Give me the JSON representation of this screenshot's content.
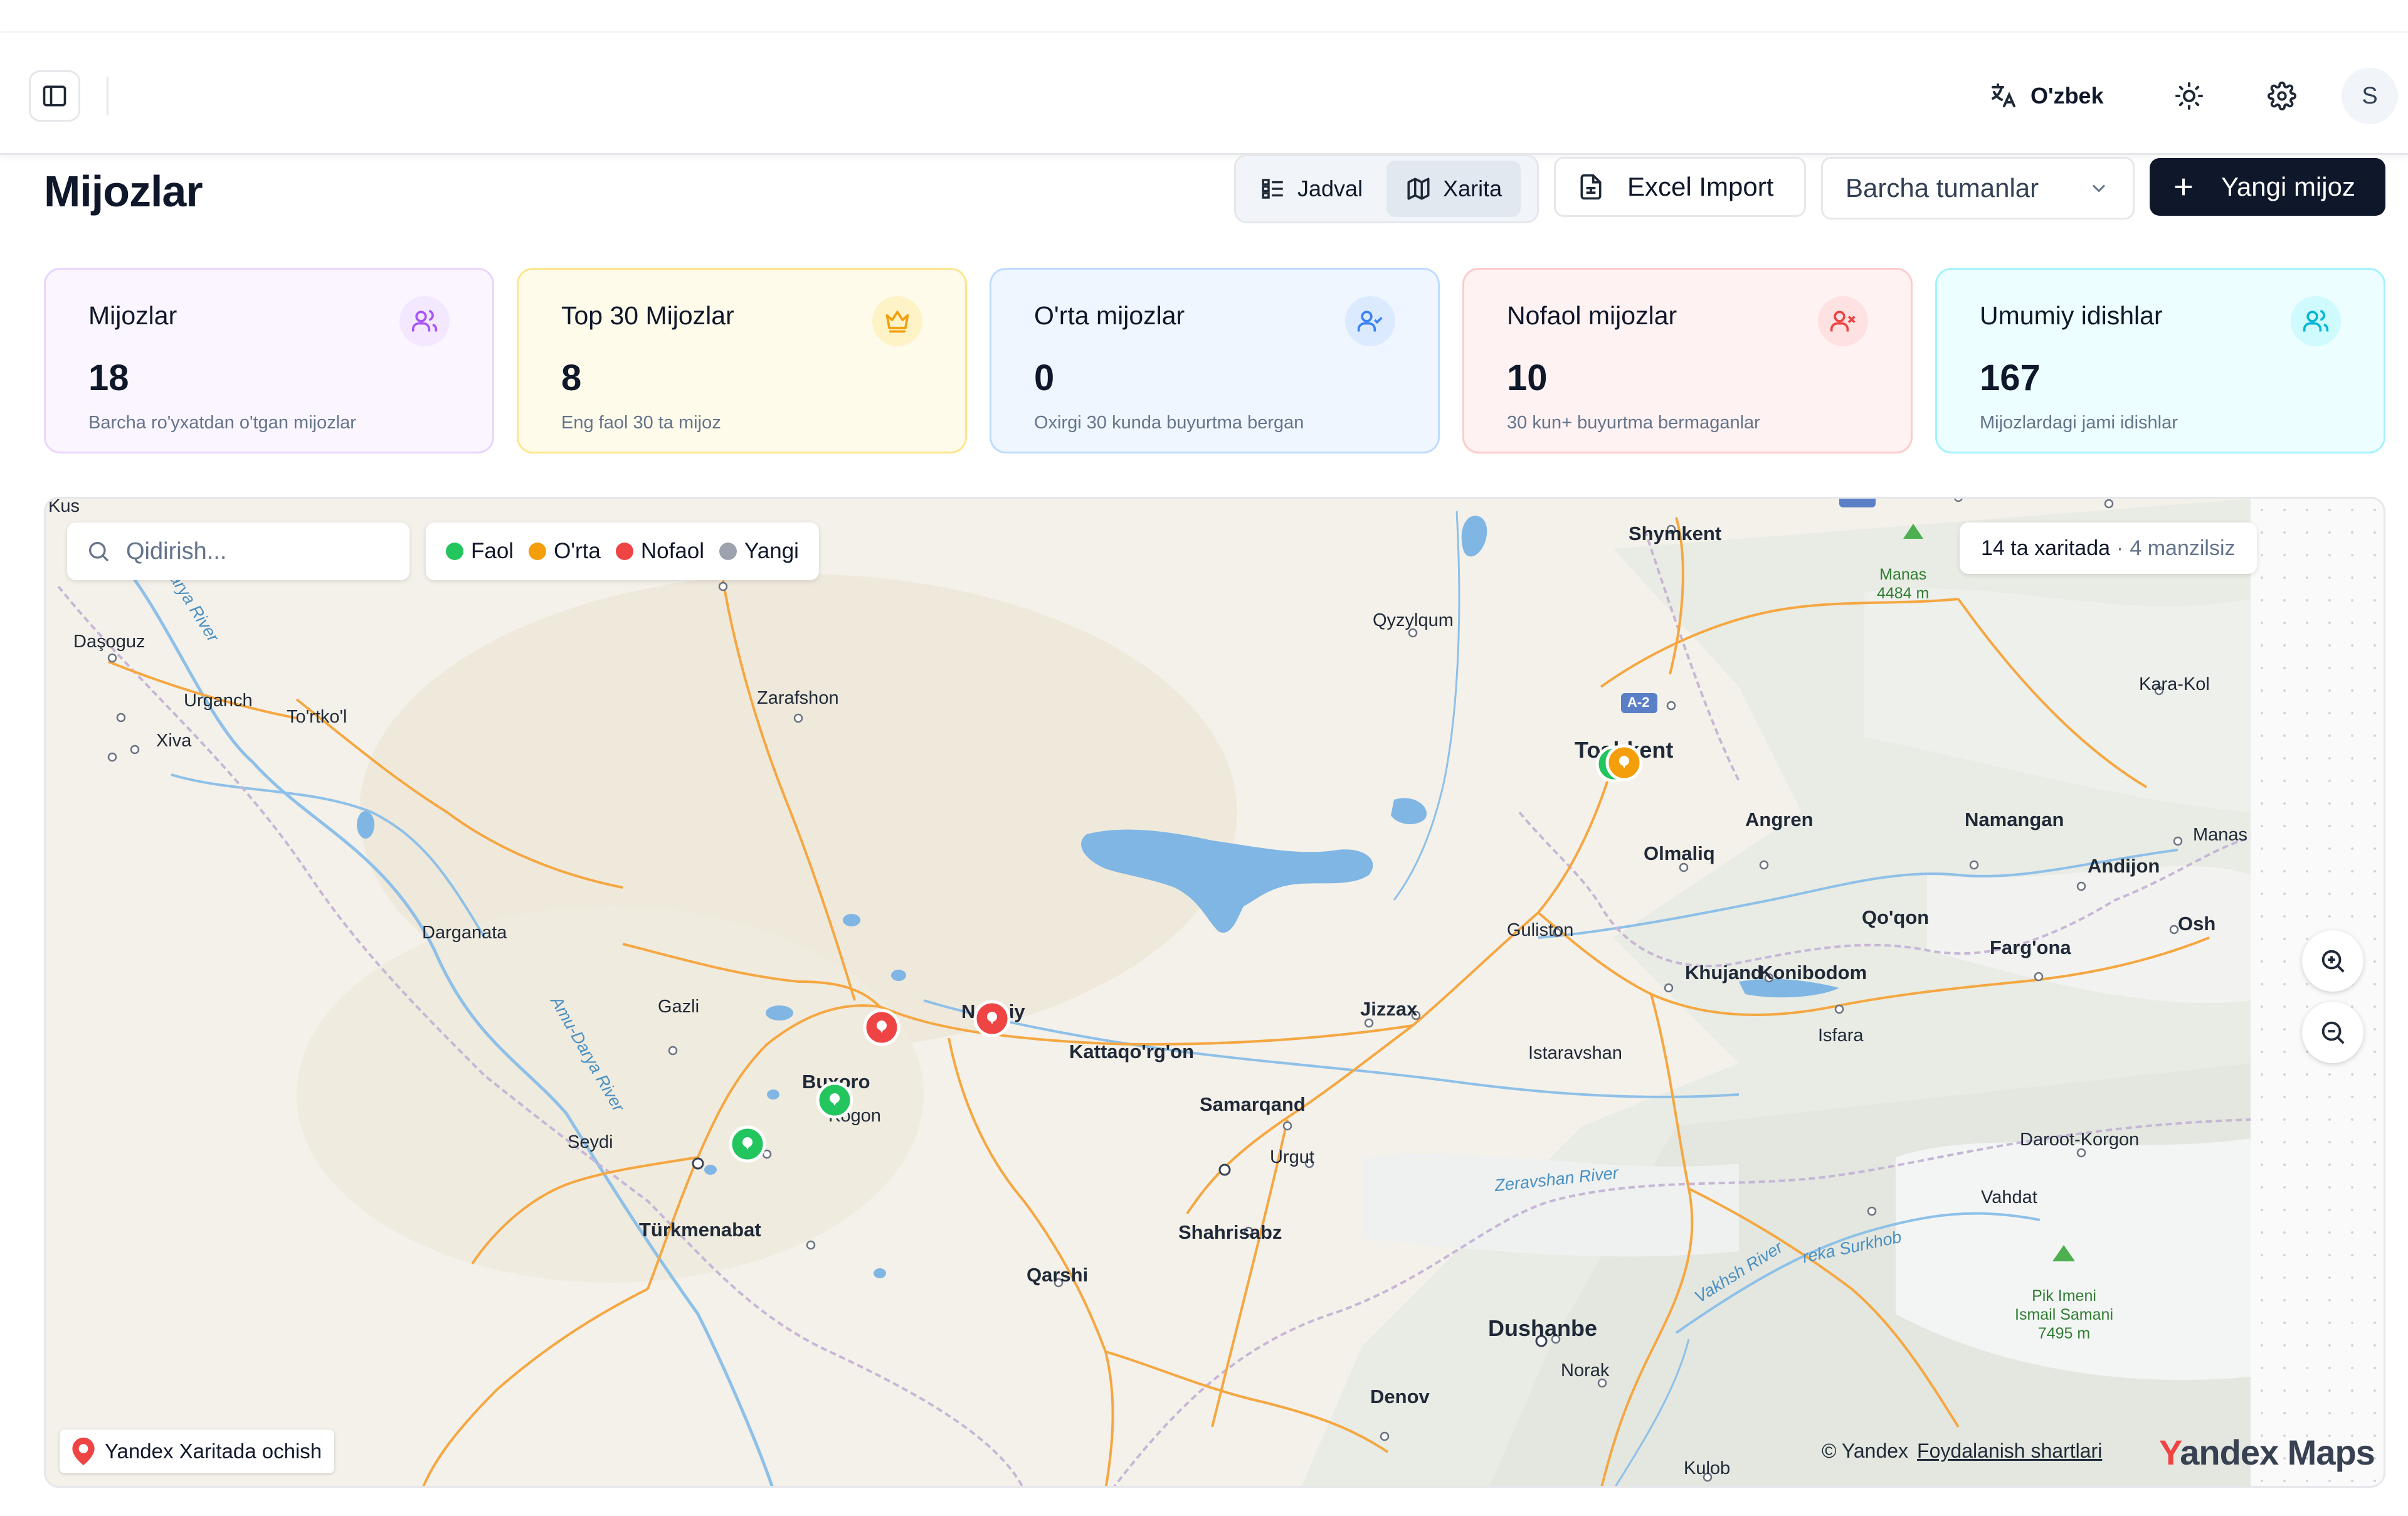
{
  "header": {
    "language_label": "O'zbek",
    "avatar_initial": "S"
  },
  "page": {
    "title": "Mijozlar"
  },
  "toolbar": {
    "view_table_label": "Jadval",
    "view_map_label": "Xarita",
    "excel_import_label": "Excel Import",
    "district_select_value": "Barcha tumanlar",
    "new_client_label": "Yangi mijoz"
  },
  "stats": [
    {
      "title": "Mijozlar",
      "value": "18",
      "desc": "Barcha ro'yxatdan o'tgan mijozlar",
      "icon": "users-icon",
      "accent": "#a855f7",
      "bg": "#faf5ff",
      "border": "#e9d5ff"
    },
    {
      "title": "Top 30 Mijozlar",
      "value": "8",
      "desc": "Eng faol 30 ta mijoz",
      "icon": "crown-icon",
      "accent": "#f59e0b",
      "bg": "#fffbeb",
      "border": "#fde68a"
    },
    {
      "title": "O'rta mijozlar",
      "value": "0",
      "desc": "Oxirgi 30 kunda buyurtma bergan",
      "icon": "user-check-icon",
      "accent": "#3b82f6",
      "bg": "#eff6ff",
      "border": "#bfdbfe"
    },
    {
      "title": "Nofaol mijozlar",
      "value": "10",
      "desc": "30 kun+ buyurtma bermaganlar",
      "icon": "user-x-icon",
      "accent": "#ef4444",
      "bg": "#fef2f2",
      "border": "#fecaca"
    },
    {
      "title": "Umumiy idishlar",
      "value": "167",
      "desc": "Mijozlardagi jami idishlar",
      "icon": "users-icon",
      "accent": "#06b6d4",
      "bg": "#ecfeff",
      "border": "#a5f3fc"
    }
  ],
  "map": {
    "search_placeholder": "Qidirish...",
    "legend": [
      {
        "label": "Faol",
        "color": "#22c55e"
      },
      {
        "label": "O'rta",
        "color": "#f59e0b"
      },
      {
        "label": "Nofaol",
        "color": "#ef4444"
      },
      {
        "label": "Yangi",
        "color": "#9ca3af"
      }
    ],
    "count_on_map": "14 ta xaritada",
    "count_separator": "·",
    "count_no_address": "4 manzilsiz",
    "open_in_yandex": "Yandex Xaritada ochish",
    "copyright": "© Yandex",
    "terms": "Foydalanish shartlari",
    "logo_y": "Y",
    "logo_rest": "andex Maps",
    "markers": [
      {
        "status": "nofaol",
        "color": "#ef4444"
      },
      {
        "status": "nofaol",
        "color": "#ef4444"
      },
      {
        "status": "faol",
        "color": "#22c55e"
      },
      {
        "status": "faol",
        "color": "#22c55e"
      },
      {
        "status": "faol",
        "color": "#22c55e"
      },
      {
        "status": "orta",
        "color": "#f59e0b"
      }
    ],
    "places": {
      "kus": "Kus",
      "dasoguz": "Daşoguz",
      "urganch": "Urganch",
      "tortkol": "To'rtko'l",
      "xiva": "Xiva",
      "zarafshon": "Zarafshon",
      "darganata": "Darganata",
      "gazli": "Gazli",
      "buxoro": "Buxoro",
      "kogon": "Kogon",
      "seydi": "Seydi",
      "turkmenabat": "Türkmenabat",
      "navoiy": "Navoiy",
      "kattaqorgon": "Kattaqo'rg'on",
      "samarqand": "Samarqand",
      "urgut": "Urgut",
      "shahrisabz": "Shahrisabz",
      "qarshi": "Qarshi",
      "jizzax": "Jizzax",
      "istaravshan": "Istaravshan",
      "guliston": "Guliston",
      "qyzylqum": "Qyzylqum",
      "shymkent": "Shymkent",
      "toshkent": "Toshkent",
      "angren": "Angren",
      "olmaliq": "Olmaliq",
      "namangan": "Namangan",
      "andijon": "Andijon",
      "qoqon": "Qo'qon",
      "fargona": "Farg'ona",
      "khujand": "Khujand",
      "konibodom": "Konibodom",
      "isfara": "Isfara",
      "osh": "Osh",
      "karakol": "Kara-Kol",
      "manas": "Manas",
      "manas_peak": "Manas",
      "manas_height": "4484 m",
      "dushanbe": "Dushanbe",
      "norak": "Norak",
      "denov": "Denov",
      "kulob": "Kulob",
      "vahdat": "Vahdat",
      "daroot": "Daroot-Korgon",
      "pik_name": "Pik Imeni",
      "pik_name2": "Ismail Samani",
      "pik_height": "7495 m",
      "zeravshan": "Zeravshan River",
      "vakhsh": "Vakhsh River",
      "surkhob": "reka Surkhob",
      "amu": "Amu-Darya River",
      "darya": "Darya River",
      "a2": "A-2"
    }
  }
}
